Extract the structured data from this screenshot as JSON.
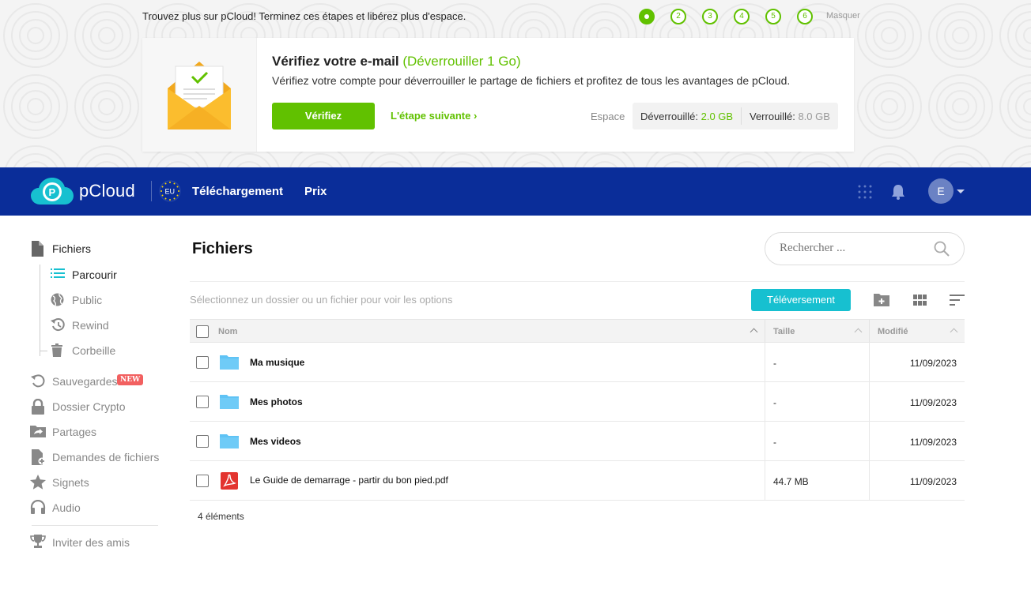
{
  "onboarding": {
    "intro": "Trouvez plus sur pCloud! Terminez ces étapes et libérez plus d'espace.",
    "steps": [
      "",
      "2",
      "3",
      "4",
      "5",
      "6"
    ],
    "hide_label": "Masquer",
    "card": {
      "title": "Vérifiez votre e-mail",
      "title_unlock": "(Déverrouiller 1 Go)",
      "description": "Vérifiez votre compte pour déverrouiller le partage de fichiers et profitez de tous les avantages de pCloud.",
      "verify_button": "Vérifiez",
      "next_step": "L'étape suivante",
      "space_label": "Espace",
      "unlocked_label": "Déverrouillé:",
      "unlocked_value": "2.0 GB",
      "locked_label": "Verrouillé:",
      "locked_value": "8.0 GB"
    }
  },
  "header": {
    "brand": "pCloud",
    "region_badge": "EU",
    "nav": [
      "Téléchargement",
      "Prix"
    ],
    "avatar_initial": "E"
  },
  "sidebar": {
    "files": "Fichiers",
    "sub_items": [
      "Parcourir",
      "Public",
      "Rewind",
      "Corbeille"
    ],
    "backups": "Sauvegardes",
    "new_badge": "NEW",
    "items": [
      "Dossier Crypto",
      "Partages",
      "Demandes de fichiers",
      "Signets",
      "Audio"
    ],
    "invite": "Inviter des amis"
  },
  "main": {
    "title": "Fichiers",
    "search_placeholder": "Rechercher ...",
    "select_hint": "Sélectionnez un dossier ou un fichier pour voir les options",
    "upload_button": "Téléversement",
    "columns": {
      "name": "Nom",
      "size": "Taille",
      "modified": "Modifié"
    },
    "rows": [
      {
        "name": "Ma musique",
        "type": "folder",
        "size": "-",
        "modified": "11/09/2023"
      },
      {
        "name": "Mes photos",
        "type": "folder",
        "size": "-",
        "modified": "11/09/2023"
      },
      {
        "name": "Mes videos",
        "type": "folder",
        "size": "-",
        "modified": "11/09/2023"
      },
      {
        "name": "Le Guide de demarrage - partir du bon pied.pdf",
        "type": "pdf",
        "size": "44.7 MB",
        "modified": "11/09/2023"
      }
    ],
    "count": "4 éléments"
  },
  "colors": {
    "brand_blue": "#0a2d99",
    "accent_green": "#61c100",
    "upload_teal": "#17c0d0",
    "folder_blue": "#5fc3f5",
    "pdf_red": "#e3342f"
  }
}
